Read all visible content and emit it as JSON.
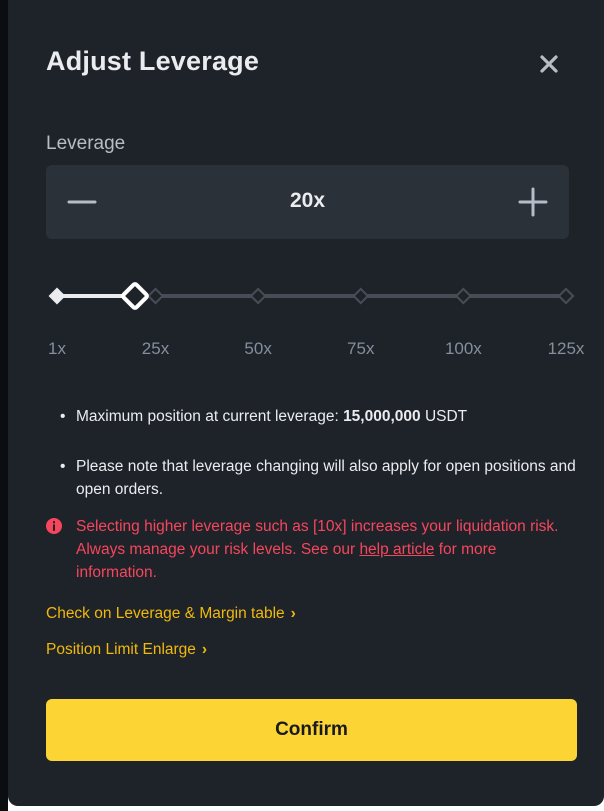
{
  "dialog": {
    "title": "Adjust Leverage",
    "close_icon": "close-icon"
  },
  "leverage": {
    "label": "Leverage",
    "value": "20x",
    "minus_icon": "minus-icon",
    "plus_icon": "plus-icon"
  },
  "slider": {
    "min": 1,
    "max": 125,
    "current": 20,
    "ticks": [
      "1x",
      "25x",
      "50x",
      "75x",
      "100x",
      "125x"
    ]
  },
  "notes": {
    "max_position_prefix": "Maximum position at current leverage: ",
    "max_position_value": "15,000,000",
    "max_position_unit": " USDT",
    "apply_note": "Please note that leverage changing will also apply for open positions and open orders."
  },
  "warning": {
    "text_before_link": "Selecting higher leverage such as [10x] increases your liquidation risk. Always manage your risk levels. See our ",
    "link_text": "help article",
    "text_after_link": " for more information."
  },
  "links": {
    "leverage_table": "Check on Leverage & Margin table",
    "position_limit": "Position Limit Enlarge"
  },
  "confirm_label": "Confirm",
  "colors": {
    "background": "#1e2329",
    "input_bg": "#2b3139",
    "accent_yellow": "#fcd535",
    "link_yellow": "#f0b90b",
    "warning_red": "#f6465d"
  }
}
